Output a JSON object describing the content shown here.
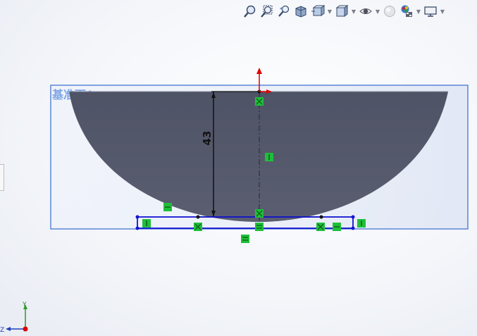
{
  "plane": {
    "label": "基准面1"
  },
  "dimension": {
    "value": "43"
  },
  "triad": {
    "y_label": "Y",
    "z_label": "Z"
  },
  "toolbar": {
    "items": [
      {
        "name": "zoom-to-fit",
        "icon": "zoom-fit-icon"
      },
      {
        "name": "zoom-to-area",
        "icon": "zoom-area-icon"
      },
      {
        "name": "previous-view",
        "icon": "previous-view-icon"
      },
      {
        "name": "section-view",
        "icon": "section-view-icon"
      },
      {
        "name": "view-orientation",
        "icon": "view-orientation-icon",
        "dropdown": true
      },
      {
        "name": "display-style",
        "icon": "display-style-icon",
        "dropdown": true
      },
      {
        "name": "hide-show-items",
        "icon": "eye-icon",
        "dropdown": true
      },
      {
        "name": "edit-appearance",
        "icon": "appearance-icon",
        "dropdown": false
      },
      {
        "name": "apply-scene",
        "icon": "scene-icon",
        "dropdown": true
      },
      {
        "name": "view-settings",
        "icon": "monitor-icon",
        "dropdown": true
      }
    ]
  },
  "colors": {
    "sketch_fill": "#545869",
    "plane_border": "#5b86d8",
    "selection_blue": "#1414d2",
    "relation_green": "#1fbf3a",
    "origin_red": "#e00000"
  }
}
